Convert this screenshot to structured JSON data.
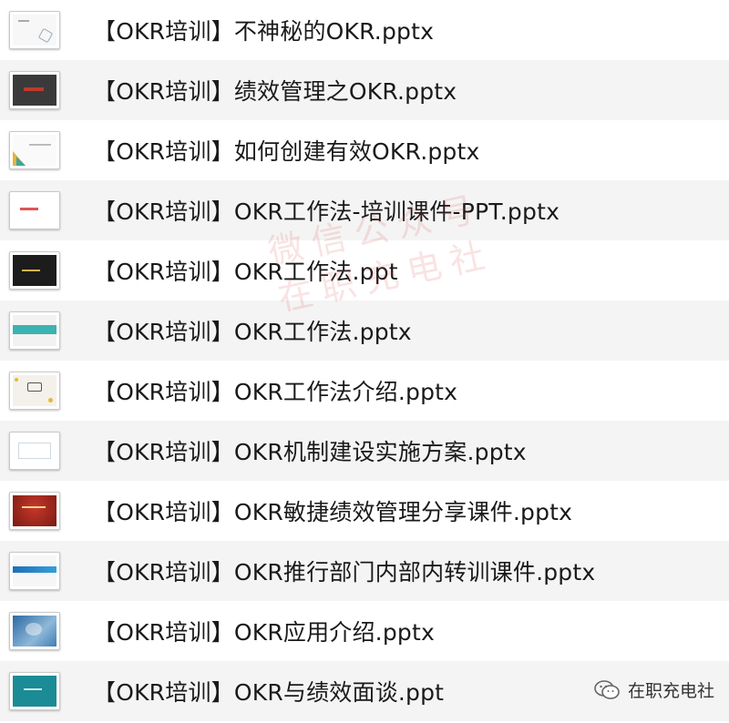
{
  "files": [
    {
      "name": "【OKR培训】不神秘的OKR.pptx",
      "thumb": "thumb-slide-white"
    },
    {
      "name": "【OKR培训】绩效管理之OKR.pptx",
      "thumb": "thumb-slide-dark-red"
    },
    {
      "name": "【OKR培训】如何创建有效OKR.pptx",
      "thumb": "thumb-slide-geometric"
    },
    {
      "name": "【OKR培训】OKR工作法-培训课件-PPT.pptx",
      "thumb": "thumb-slide-white-red"
    },
    {
      "name": "【OKR培训】OKR工作法.ppt",
      "thumb": "thumb-slide-black"
    },
    {
      "name": "【OKR培训】OKR工作法.pptx",
      "thumb": "thumb-slide-teal-band"
    },
    {
      "name": "【OKR培训】OKR工作法介绍.pptx",
      "thumb": "thumb-slide-okr"
    },
    {
      "name": "【OKR培训】OKR机制建设实施方案.pptx",
      "thumb": "thumb-slide-white-frame"
    },
    {
      "name": "【OKR培训】OKR敏捷绩效管理分享课件.pptx",
      "thumb": "thumb-slide-red"
    },
    {
      "name": "【OKR培训】OKR推行部门内部内转训课件.pptx",
      "thumb": "thumb-slide-blue-band"
    },
    {
      "name": "【OKR培训】OKR应用介绍.pptx",
      "thumb": "thumb-slide-blue-photo"
    },
    {
      "name": "【OKR培训】OKR与绩效面谈.ppt",
      "thumb": "thumb-slide-teal"
    }
  ],
  "watermark": {
    "line1": "微信公众号",
    "line2": "在职充电社"
  },
  "brand": {
    "label": "在职充电社",
    "icon": "wechat-icon"
  },
  "colors": {
    "row_alt": "#f4f4f4",
    "text": "#1a1a1a",
    "watermark": "#dc5050"
  }
}
